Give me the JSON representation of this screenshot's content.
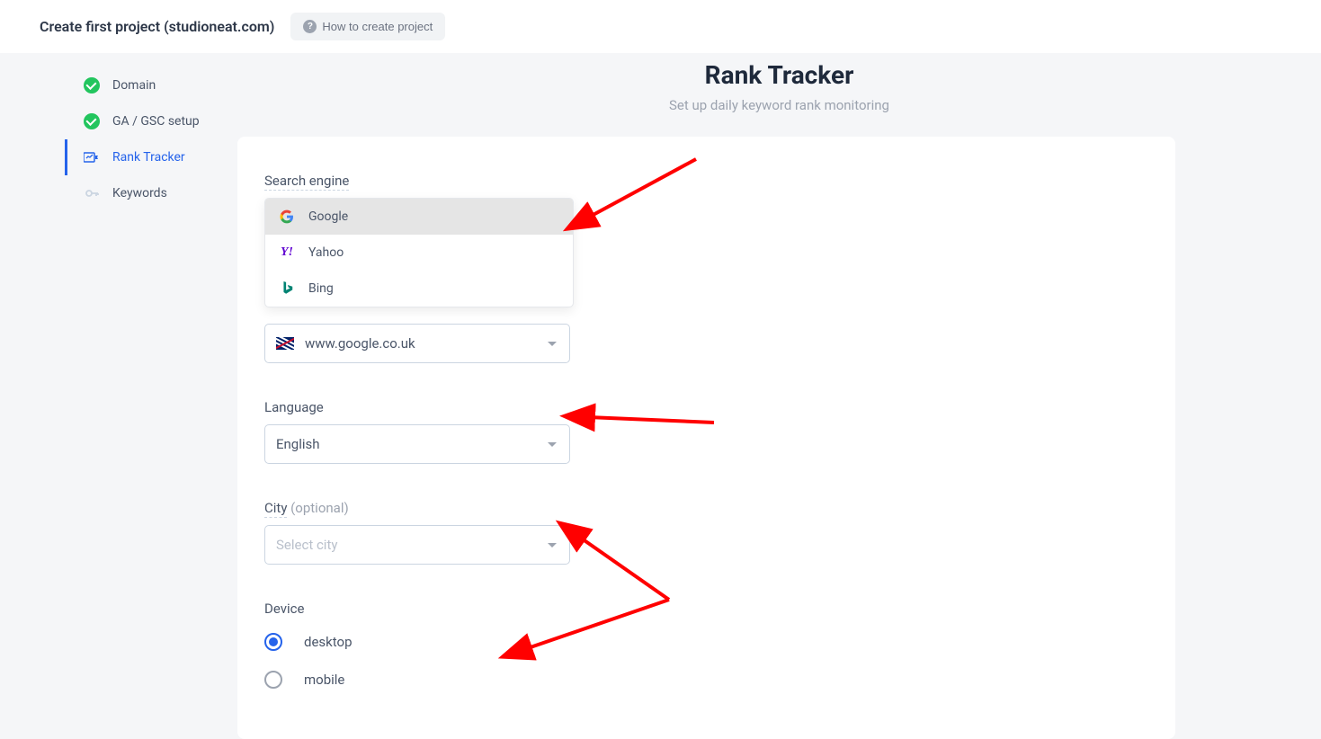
{
  "header": {
    "title": "Create first project (studioneat.com)",
    "help_label": "How to create project"
  },
  "sidebar": {
    "items": [
      {
        "label": "Domain",
        "completed": true,
        "active": false
      },
      {
        "label": "GA / GSC setup",
        "completed": true,
        "active": false
      },
      {
        "label": "Rank Tracker",
        "completed": false,
        "active": true
      },
      {
        "label": "Keywords",
        "completed": false,
        "active": false
      }
    ]
  },
  "page": {
    "title": "Rank Tracker",
    "subtitle": "Set up daily keyword rank monitoring"
  },
  "form": {
    "search_engine": {
      "label": "Search engine",
      "options": [
        {
          "label": "Google",
          "brand": "google"
        },
        {
          "label": "Yahoo",
          "brand": "yahoo"
        },
        {
          "label": "Bing",
          "brand": "bing"
        }
      ],
      "selected_index": 0
    },
    "region": {
      "value": "www.google.co.uk",
      "flag": "uk"
    },
    "language": {
      "label": "Language",
      "value": "English"
    },
    "city": {
      "label": "City",
      "optional_hint": "(optional)",
      "placeholder": "Select city",
      "value": ""
    },
    "device": {
      "label": "Device",
      "options": [
        {
          "label": "desktop",
          "checked": true
        },
        {
          "label": "mobile",
          "checked": false
        }
      ]
    }
  }
}
